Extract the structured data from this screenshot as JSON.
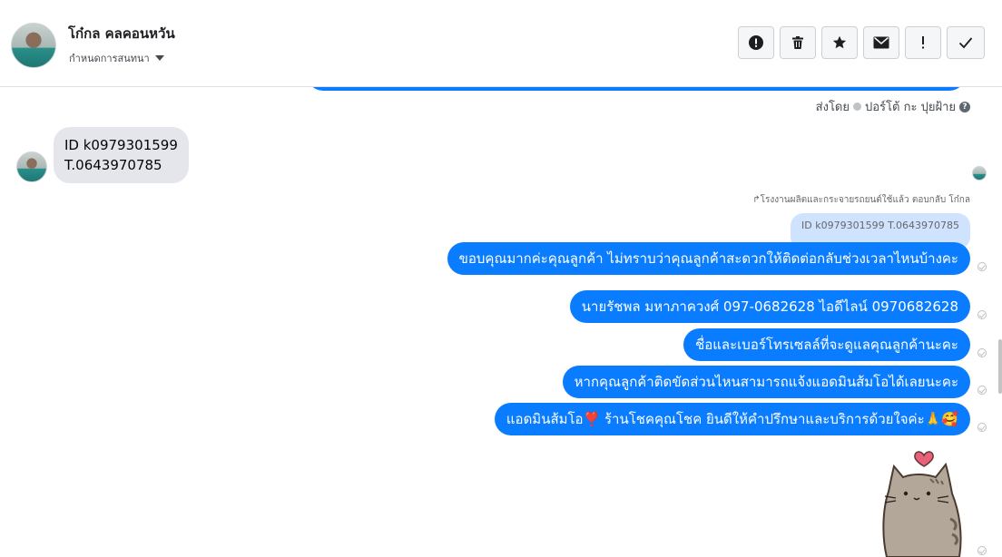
{
  "header": {
    "contact_name": "โก๋กล คลคอนหวัน",
    "subtitle": "กำหนดการสนทนา",
    "toolbar": [
      {
        "name": "report-icon",
        "label": "report"
      },
      {
        "name": "trash-icon",
        "label": "delete"
      },
      {
        "name": "star-icon",
        "label": "star"
      },
      {
        "name": "envelope-icon",
        "label": "mark unread"
      },
      {
        "name": "exclamation-icon",
        "label": "spam"
      },
      {
        "name": "checkmark-icon",
        "label": "done"
      }
    ]
  },
  "conversation": {
    "sent_by": "ส่งโดย",
    "sent_by_name": "ปอร์โต้ กะ ปุยฝ้าย",
    "incoming_message": {
      "line1": "ID k0979301599",
      "line2": "T.0643970785"
    },
    "reply_note": "↱โรงงานผลิตและกระจายรถยนต์ใช้แล้ว ตอบกลับ โก๋กล",
    "quoted_text": "ID k0979301599 T.0643970785",
    "outgoing_messages": [
      "ขอบคุณมากค่ะคุณลูกค้า ไม่ทราบว่าคุณลูกค้าสะดวกให้ติดต่อกลับช่วงเวลาไหนบ้างคะ",
      "นายรัชพล มหาภาควงศ์  097-0682628 ไอดีไลน์ 0970682628",
      "ชื่อและเบอร์โทรเซลล์ที่จะดูแลคุณลูกค้านะคะ",
      "หากคุณลูกค้าติดขัดส่วนไหนสามารถแจ้งแอดมินส้มโอได้เลยนะคะ",
      "แอดมินส้มโอ❣️ ร้านโชคคุณโชค ยินดีให้คำปรึกษาและบริการด้วยใจค่ะ🙏🥰"
    ],
    "sticker": "pusheen-cat-heart-sticker"
  },
  "colors": {
    "outgoing_bubble": "#0a7cff",
    "incoming_bubble": "#e4e6eb",
    "quoted_bubble": "#cfe3ff"
  }
}
